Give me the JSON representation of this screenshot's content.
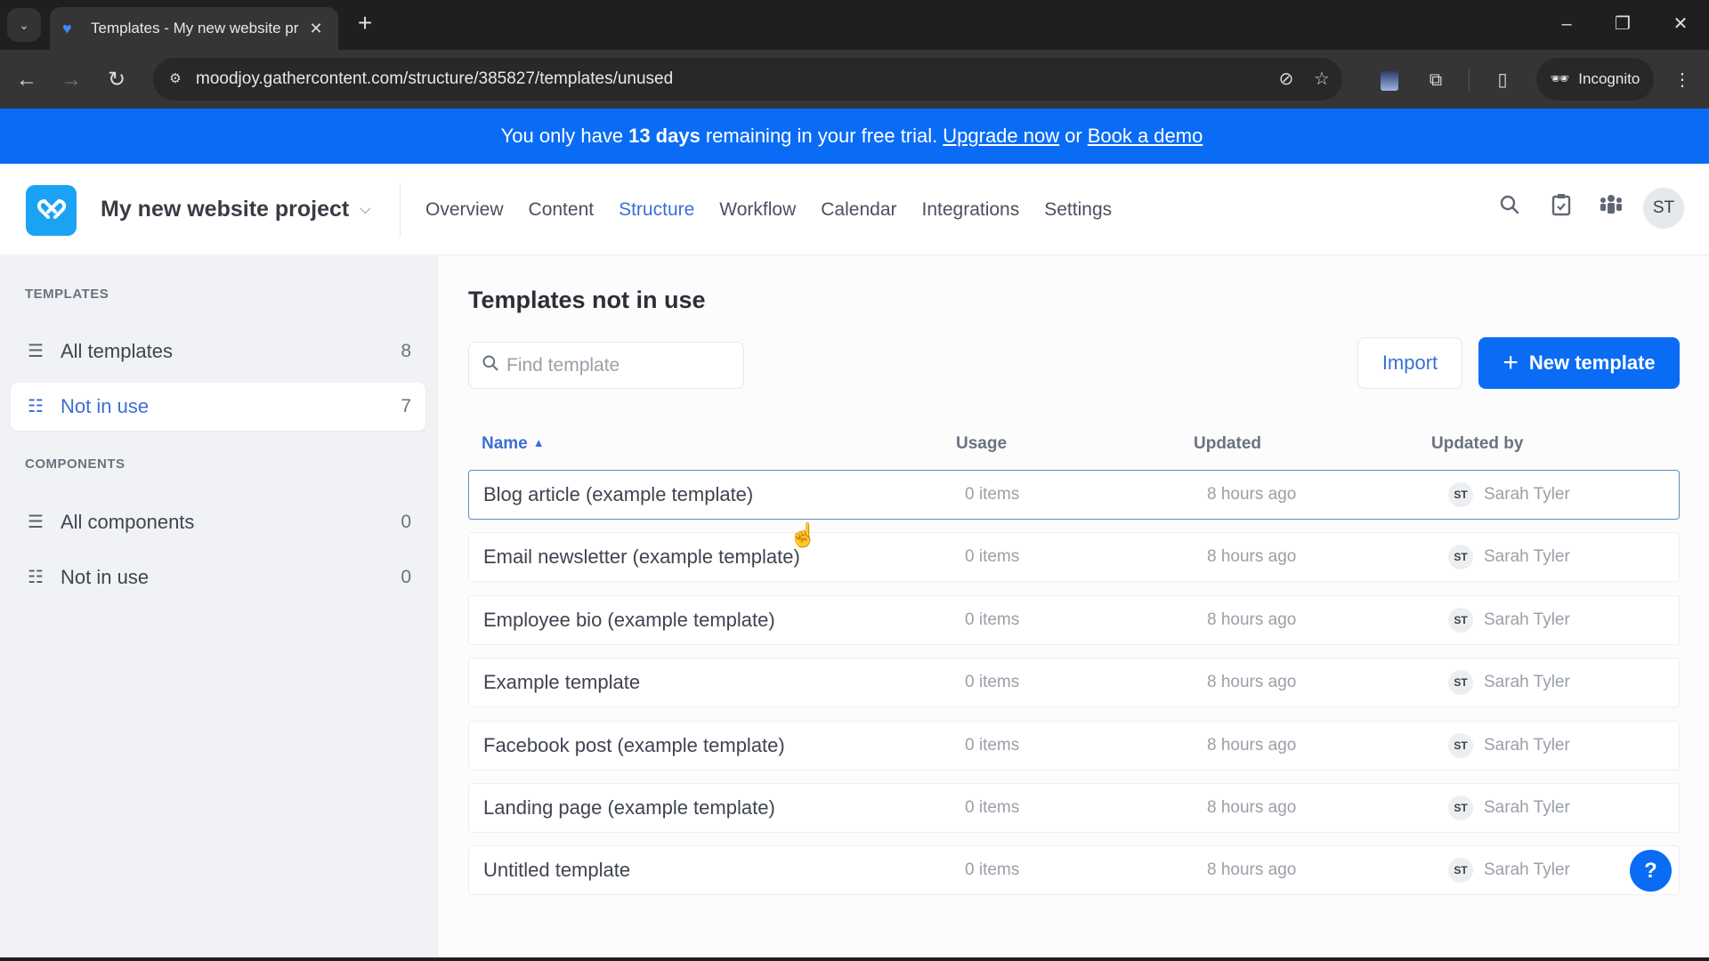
{
  "browser": {
    "tab_title": "Templates - My new website pr",
    "url": "moodjoy.gathercontent.com/structure/385827/templates/unused",
    "incognito_label": "Incognito",
    "icons": {
      "tab_search": "chevron-down-icon",
      "favicon": "gathercontent-logo-icon",
      "tab_close": "close-icon",
      "new_tab": "plus-icon",
      "back": "arrow-left-icon",
      "forward": "arrow-right-icon",
      "reload": "reload-icon",
      "site_info": "tune-icon",
      "eye_off": "eye-off-icon",
      "bookmark": "star-icon",
      "extension": "extension-icon",
      "puzzle": "puzzle-icon",
      "side_panel": "side-panel-icon",
      "menu": "kebab-menu-icon"
    },
    "window": {
      "minimize": "–",
      "restore": "❐",
      "close": "✕"
    }
  },
  "banner": {
    "text_before": "You only have",
    "highlight": "13 days",
    "text_after": "remaining in your free trial.",
    "upgrade_link": "Upgrade now",
    "separator": "or",
    "demo_link": "Book a demo",
    "background": "#0a6cf5"
  },
  "header": {
    "project_name": "My new website project",
    "nav": [
      {
        "label": "Overview",
        "active": false
      },
      {
        "label": "Content",
        "active": false
      },
      {
        "label": "Structure",
        "active": true
      },
      {
        "label": "Workflow",
        "active": false
      },
      {
        "label": "Calendar",
        "active": false
      },
      {
        "label": "Integrations",
        "active": false
      },
      {
        "label": "Settings",
        "active": false
      }
    ],
    "avatar_initials": "ST",
    "accent": "#3b6fd6"
  },
  "sidebar": {
    "templates_heading": "TEMPLATES",
    "templates_items": [
      {
        "label": "All templates",
        "count": "8",
        "active": false
      },
      {
        "label": "Not in use",
        "count": "7",
        "active": true
      }
    ],
    "components_heading": "COMPONENTS",
    "components_items": [
      {
        "label": "All components",
        "count": "0",
        "active": false
      },
      {
        "label": "Not in use",
        "count": "0",
        "active": false
      }
    ]
  },
  "main": {
    "title": "Templates not in use",
    "search_placeholder": "Find template",
    "search_value": "",
    "import_label": "Import",
    "new_template_label": "New template",
    "columns": {
      "name": "Name",
      "usage": "Usage",
      "updated": "Updated",
      "updated_by": "Updated by"
    },
    "sort": {
      "column": "name",
      "direction": "ascending"
    },
    "rows": [
      {
        "name": "Blog article (example template)",
        "usage": "0 items",
        "updated": "8 hours ago",
        "initials": "ST",
        "updated_by": "Sarah Tyler"
      },
      {
        "name": "Email newsletter (example template)",
        "usage": "0 items",
        "updated": "8 hours ago",
        "initials": "ST",
        "updated_by": "Sarah Tyler"
      },
      {
        "name": "Employee bio (example template)",
        "usage": "0 items",
        "updated": "8 hours ago",
        "initials": "ST",
        "updated_by": "Sarah Tyler"
      },
      {
        "name": "Example template",
        "usage": "0 items",
        "updated": "8 hours ago",
        "initials": "ST",
        "updated_by": "Sarah Tyler"
      },
      {
        "name": "Facebook post (example template)",
        "usage": "0 items",
        "updated": "8 hours ago",
        "initials": "ST",
        "updated_by": "Sarah Tyler"
      },
      {
        "name": "Landing page (example template)",
        "usage": "0 items",
        "updated": "8 hours ago",
        "initials": "ST",
        "updated_by": "Sarah Tyler"
      },
      {
        "name": "Untitled template",
        "usage": "0 items",
        "updated": "8 hours ago",
        "initials": "ST",
        "updated_by": "Sarah Tyler"
      }
    ],
    "help_label": "?"
  }
}
